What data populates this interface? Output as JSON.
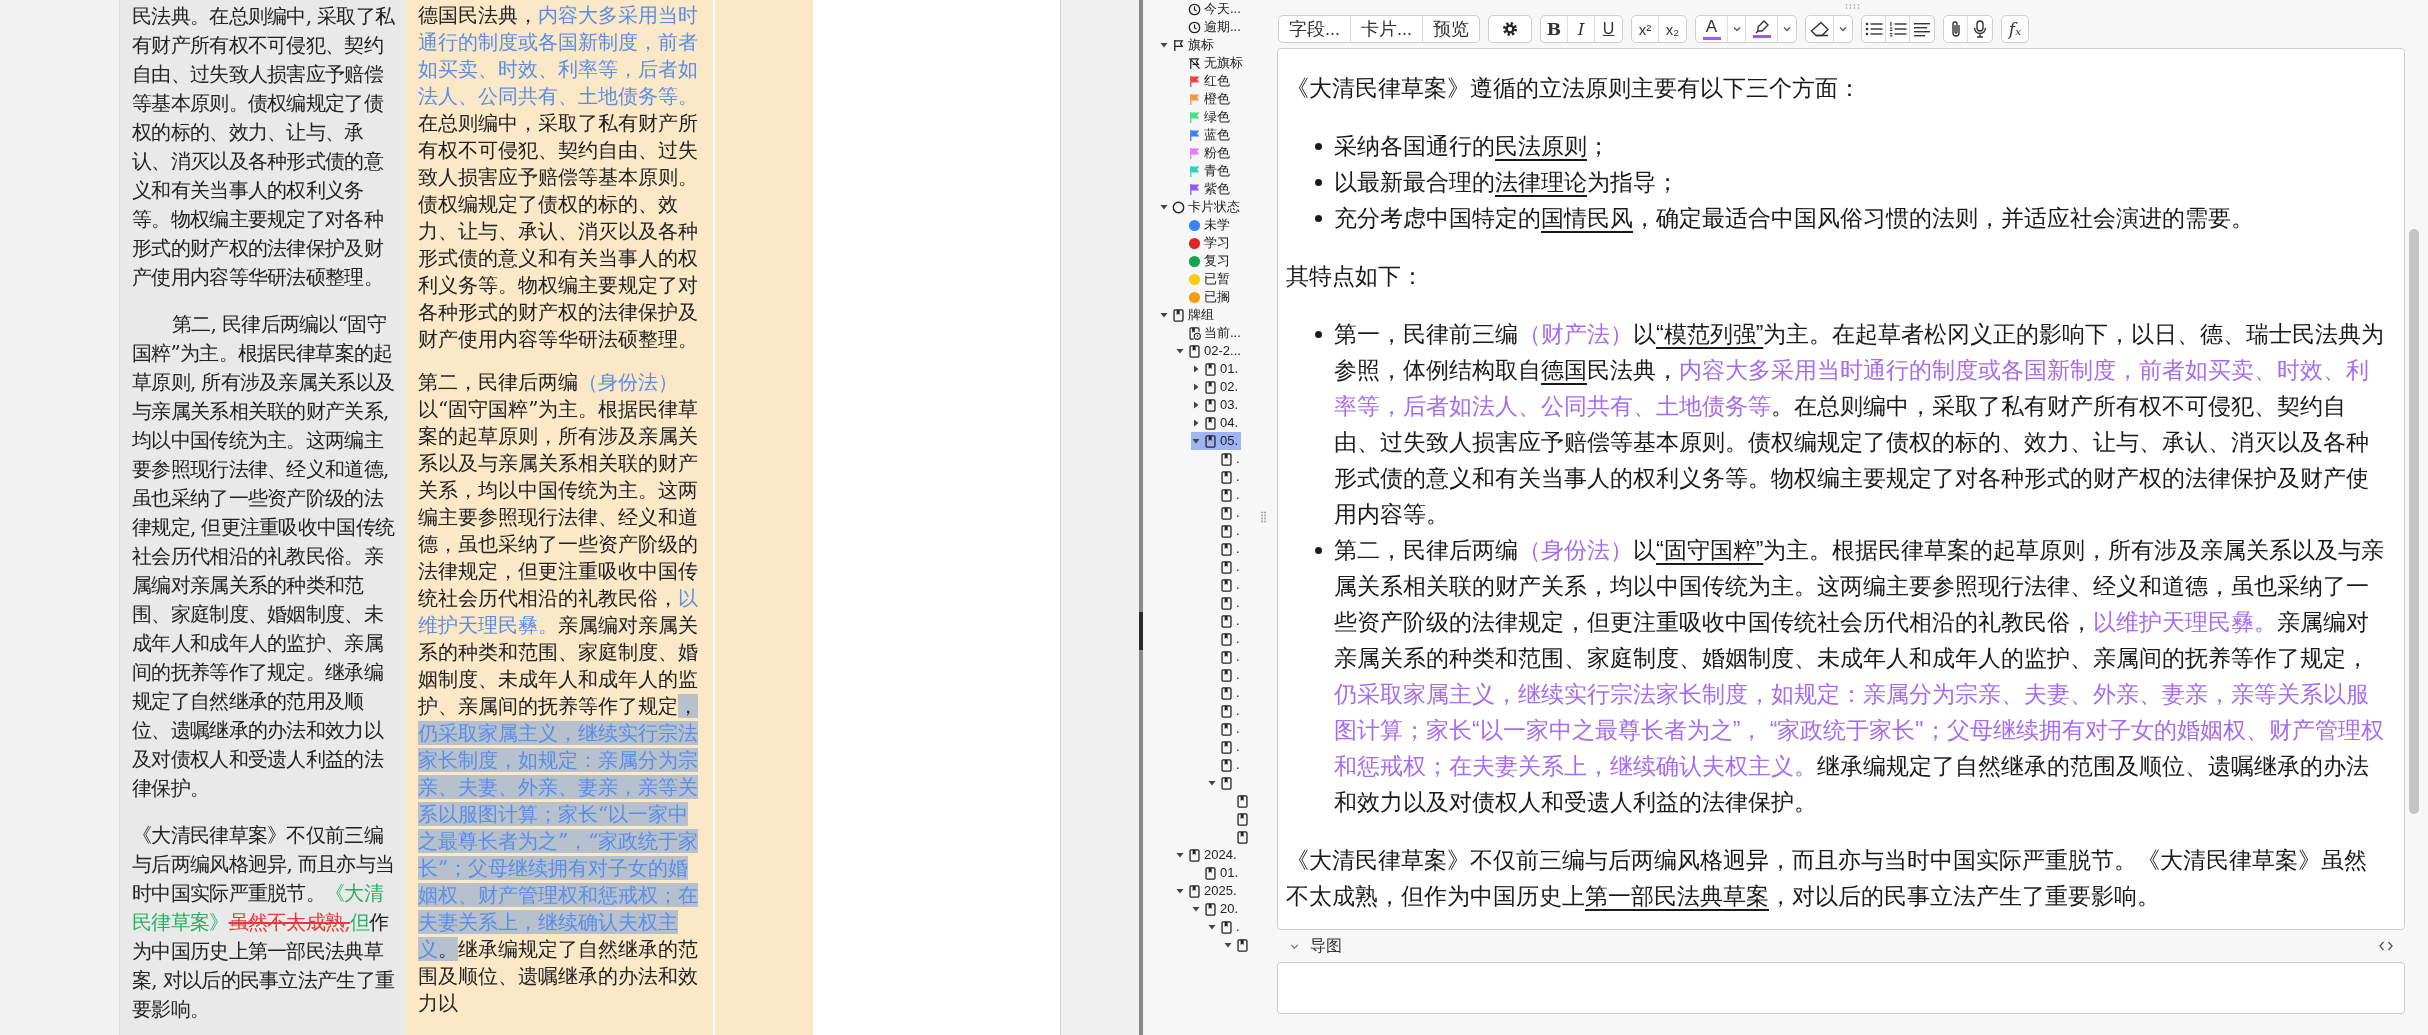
{
  "left_page": {
    "paragraphs": [
      {
        "indented": false,
        "runs": [
          {
            "kind": "plain",
            "text": "民法典。在总则编中, 采取了私有财产所有权不可侵犯、契约自由、过失致人损害应予赔偿等基本原则。债权编规定了债权的标的、效力、让与、承认、消灭以及各种形式债的意义和有关当事人的权利义务等。物权编主要规定了对各种形式的财产权的法律保护及财产使用内容等华研法硕整理。"
          }
        ]
      },
      {
        "indented": true,
        "runs": [
          {
            "kind": "plain",
            "text": "第二, 民律后两编以“固守国粹”为主。根据民律草案的起草原则, 所有涉及亲属关系以及与亲属关系相关联的财产关系, 均以中国传统为主。这两编主要参照现行法律、经义和道德, 虽也采纳了一些资产阶级的法律规定, 但更注重吸收中国传统社会历代相沿的礼教民俗。亲属编对亲属关系的种类和范围、家庭制度、婚姻制度、未成年人和成年人的监护、亲属间的抚养等作了规定。继承编规定了自然继承的范用及顺位、遗嘱继承的办法和效力以及对债权人和受遗人利益的法律保护。"
          }
        ]
      },
      {
        "indented": false,
        "runs": [
          {
            "kind": "plain",
            "text": "《大清民律草案》不仅前三编与后两编风格迥异, 而且亦与当时中国实际严重脱节。"
          },
          {
            "kind": "green",
            "text": "《大清民律草案》"
          },
          {
            "kind": "strike",
            "text": "虽然不太成熟,"
          },
          {
            "kind": "green",
            "text": "但"
          },
          {
            "kind": "plain",
            "text": "作为中国历史上第一部民法典草案, 对以后的民事立法产生了重要影响。"
          }
        ]
      }
    ]
  },
  "middle_page": {
    "paragraphs": [
      {
        "runs": [
          {
            "kind": "plain",
            "text": "德国民法典，"
          },
          {
            "kind": "blue",
            "text": "内容大多采用当时通行的制度或各国新制度，前者如买卖、时效、利率等，后者如法人、公同共有、土地债务等。"
          },
          {
            "kind": "plain",
            "text": "在总则编中，采取了私有财产所有权不可侵犯、契约自由、过失致人损害应予赔偿等基本原则。债权编规定了债权的标的、效力、让与、承认、消灭以及各种形式债的意义和有关当事人的权利义务等。物权编主要规定了对各种形式的财产权的法律保护及财产使用内容等华研法硕整理。"
          }
        ]
      },
      {
        "runs": [
          {
            "kind": "plain",
            "text": "第二，民律后两编"
          },
          {
            "kind": "blue",
            "text": "（身份法）"
          },
          {
            "kind": "plain",
            "text": "以“固守国粹”为主。根据民律草案的起草原则，所有涉及亲属关系以及与亲属关系相关联的财产关系，均以中国传统为主。这两编主要参照现行法律、经义和道德，虽也采纳了一些资产阶级的法律规定，但更注重吸收中国传统社会历代相沿的礼教民俗，"
          },
          {
            "kind": "blue",
            "text": "以维护天理民彝。"
          },
          {
            "kind": "plain",
            "text": "亲属编对亲属关系的种类和范围、家庭制度、婚姻制度、未成年人和成年人的监护、亲属间的抚养等作了规定"
          },
          {
            "kind": "highlight",
            "text": "，"
          },
          {
            "kind": "highlight-blue",
            "text": "仍采取家属主义，继续实行宗法家长制度，如规定：亲属分为宗亲、夫妻、外亲、妻亲，亲等关系以服图计算；家长“以一家中之最尊长者为之”，“家政统于家长”；父母继续拥有对子女的婚姻权、财产管理权和惩戒权；在夫妻关系上，继续确认夫权主义"
          },
          {
            "kind": "highlight",
            "text": "。"
          },
          {
            "kind": "plain",
            "text": "继承编规定了自然继承的范围及顺位、遗嘱继承的办法和效力以"
          }
        ]
      }
    ]
  },
  "sidebar": {
    "tree_top": [
      {
        "label": "今天...",
        "kind": "clock",
        "selected": false
      },
      {
        "label": "逾期...",
        "kind": "clock",
        "selected": false
      }
    ],
    "tree": [
      {
        "label": "旗标",
        "kind": "flag-outline",
        "expanded": true,
        "selected": false,
        "children": [
          {
            "label": "无旗标",
            "kind": "flag-off",
            "selected": false
          },
          {
            "label": "红色",
            "kind": "flag",
            "color": "#ef4444",
            "selected": false
          },
          {
            "label": "橙色",
            "kind": "flag",
            "color": "#fb923c",
            "selected": false
          },
          {
            "label": "绿色",
            "kind": "flag",
            "color": "#4ade80",
            "selected": false
          },
          {
            "label": "蓝色",
            "kind": "flag",
            "color": "#3b82f6",
            "selected": false
          },
          {
            "label": "粉色",
            "kind": "flag",
            "color": "#e879f9",
            "selected": false
          },
          {
            "label": "青色",
            "kind": "flag",
            "color": "#2dd4bf",
            "selected": false
          },
          {
            "label": "紫色",
            "kind": "flag",
            "color": "#8b5cf6",
            "selected": false
          }
        ]
      },
      {
        "label": "卡片状态",
        "kind": "circle",
        "expanded": true,
        "selected": false,
        "children": [
          {
            "label": "未学",
            "kind": "dot",
            "color": "#3b82f6",
            "selected": false
          },
          {
            "label": "学习",
            "kind": "dot",
            "color": "#dc2626",
            "selected": false
          },
          {
            "label": "复习",
            "kind": "dot",
            "color": "#16a34a",
            "selected": false
          },
          {
            "label": "已暂",
            "kind": "dot",
            "color": "#facc15",
            "selected": false
          },
          {
            "label": "已搁",
            "kind": "dot",
            "color": "#f59e0b",
            "selected": false
          }
        ]
      },
      {
        "label": "牌组",
        "kind": "deck",
        "expanded": true,
        "selected": false,
        "children": [
          {
            "label": "当前...",
            "kind": "deck-clock",
            "selected": false
          },
          {
            "label": "02-2...",
            "kind": "deck",
            "expanded": true,
            "selected": false,
            "children": [
              {
                "label": "01.",
                "kind": "deck",
                "expanded": false,
                "selected": false
              },
              {
                "label": "02.",
                "kind": "deck",
                "expanded": false,
                "selected": false
              },
              {
                "label": "03.",
                "kind": "deck",
                "expanded": false,
                "selected": false
              },
              {
                "label": "04.",
                "kind": "deck",
                "expanded": false,
                "selected": false
              },
              {
                "label": "05.",
                "kind": "deck",
                "expanded": true,
                "selected": true,
                "children": [
                  {
                    "label": ".",
                    "kind": "deck",
                    "selected": false
                  },
                  {
                    "label": ".",
                    "kind": "deck",
                    "selected": false
                  },
                  {
                    "label": ".",
                    "kind": "deck",
                    "selected": false
                  },
                  {
                    "label": ".",
                    "kind": "deck",
                    "selected": false
                  },
                  {
                    "label": ".",
                    "kind": "deck",
                    "selected": false
                  },
                  {
                    "label": ".",
                    "kind": "deck",
                    "selected": false
                  },
                  {
                    "label": ".",
                    "kind": "deck",
                    "selected": false
                  },
                  {
                    "label": ".",
                    "kind": "deck",
                    "selected": false
                  },
                  {
                    "label": ".",
                    "kind": "deck",
                    "selected": false
                  },
                  {
                    "label": ".",
                    "kind": "deck",
                    "selected": false
                  },
                  {
                    "label": ".",
                    "kind": "deck",
                    "selected": false
                  },
                  {
                    "label": ".",
                    "kind": "deck",
                    "selected": false
                  },
                  {
                    "label": ".",
                    "kind": "deck",
                    "selected": false
                  },
                  {
                    "label": ".",
                    "kind": "deck",
                    "selected": false
                  },
                  {
                    "label": ".",
                    "kind": "deck",
                    "selected": false
                  },
                  {
                    "label": ".",
                    "kind": "deck",
                    "selected": false
                  },
                  {
                    "label": ".",
                    "kind": "deck",
                    "selected": false
                  },
                  {
                    "label": ".",
                    "kind": "deck",
                    "selected": false
                  },
                  {
                    "kind": "deck",
                    "expanded": true,
                    "selected": false,
                    "children": [
                      {
                        "kind": "deck",
                        "selected": false
                      },
                      {
                        "kind": "deck",
                        "selected": false
                      },
                      {
                        "kind": "deck",
                        "selected": false
                      }
                    ]
                  }
                ]
              }
            ]
          },
          {
            "label": "2024.",
            "kind": "deck",
            "expanded": true,
            "selected": false,
            "children": [
              {
                "label": "01.",
                "kind": "deck",
                "selected": false
              }
            ]
          },
          {
            "label": "2025.",
            "kind": "deck",
            "expanded": true,
            "selected": false,
            "children": [
              {
                "label": "20.",
                "kind": "deck",
                "expanded": true,
                "selected": false,
                "children": [
                  {
                    "label": ".",
                    "kind": "deck",
                    "expanded": true,
                    "selected": false,
                    "children": [
                      {
                        "kind": "deck",
                        "expanded": true,
                        "selected": false
                      }
                    ]
                  }
                ]
              }
            ]
          }
        ]
      }
    ]
  },
  "toolbar": {
    "groups": [
      {
        "buttons": [
          {
            "kind": "text",
            "label": "字段..."
          },
          {
            "kind": "text",
            "label": "卡片..."
          },
          {
            "kind": "text",
            "label": "预览"
          }
        ]
      },
      {
        "buttons": [
          {
            "kind": "settings"
          }
        ]
      },
      {
        "buttons": [
          {
            "kind": "bold",
            "label": "B"
          },
          {
            "kind": "italic",
            "label": "I"
          },
          {
            "kind": "underline",
            "label": "U"
          }
        ]
      },
      {
        "buttons": [
          {
            "kind": "superscript",
            "label": "x²"
          },
          {
            "kind": "subscript",
            "label": "x₂"
          }
        ]
      },
      {
        "buttons": [
          {
            "kind": "text-color",
            "label": "A",
            "color": "#a855f7"
          },
          {
            "kind": "dropdown"
          },
          {
            "kind": "highlight",
            "color": "#a855f7"
          },
          {
            "kind": "dropdown"
          }
        ]
      },
      {
        "buttons": [
          {
            "kind": "eraser"
          },
          {
            "kind": "dropdown"
          }
        ]
      },
      {
        "buttons": [
          {
            "kind": "bullet-list"
          },
          {
            "kind": "numbered-list"
          },
          {
            "kind": "align"
          }
        ]
      },
      {
        "buttons": [
          {
            "kind": "attach"
          },
          {
            "kind": "mic"
          }
        ]
      },
      {
        "buttons": [
          {
            "kind": "function",
            "label": "fₓ"
          }
        ]
      }
    ]
  },
  "editor": {
    "blocks": [
      {
        "kind": "paragraph",
        "runs": [
          {
            "kind": "plain",
            "text": "《大清民律草案》遵循的立法原则主要有以下三个方面："
          }
        ]
      },
      {
        "kind": "list",
        "items": [
          {
            "runs": [
              {
                "kind": "plain",
                "text": "采纳各国通行的"
              },
              {
                "kind": "underline",
                "text": "民法原则"
              },
              {
                "kind": "plain",
                "text": "；"
              }
            ]
          },
          {
            "runs": [
              {
                "kind": "plain",
                "text": "以最新最合理的"
              },
              {
                "kind": "underline",
                "text": "法律理论"
              },
              {
                "kind": "plain",
                "text": "为指导；"
              }
            ]
          },
          {
            "runs": [
              {
                "kind": "plain",
                "text": "充分考虑中国特定的"
              },
              {
                "kind": "underline",
                "text": "国情民风"
              },
              {
                "kind": "plain",
                "text": "，确定最适合中国风俗习惯的法则，并适应社会演进的需要。"
              }
            ]
          }
        ]
      },
      {
        "kind": "paragraph",
        "runs": [
          {
            "kind": "plain",
            "text": "其特点如下："
          }
        ]
      },
      {
        "kind": "list",
        "items": [
          {
            "runs": [
              {
                "kind": "plain",
                "text": "第一，民律前三编"
              },
              {
                "kind": "purple",
                "text": "（财产法）"
              },
              {
                "kind": "plain",
                "text": "以"
              },
              {
                "kind": "underline",
                "text": "“模范列强”"
              },
              {
                "kind": "plain",
                "text": "为主。在起草者松冈义正的影响下，以日、德、瑞士民法典为参照，体例结构取自"
              },
              {
                "kind": "underline",
                "text": "德国"
              },
              {
                "kind": "plain",
                "text": "民法典，"
              },
              {
                "kind": "purple",
                "text": "内容大多采用当时通行的制度或各国新制度，前者如买卖、时效、利率等，后者如法人、公同共有、土地债务等"
              },
              {
                "kind": "plain",
                "text": "。在总则编中，采取了私有财产所有权不可侵犯、契约自由、过失致人损害应予赔偿等基本原则。债权编规定了债权的标的、效力、让与、承认、消灭以及各种形式债的意义和有关当事人的权利义务等。物权编主要规定了对各种形式的财产权的法律保护及财产使用内容等。"
              }
            ]
          },
          {
            "runs": [
              {
                "kind": "plain",
                "text": "第二，民律后两编"
              },
              {
                "kind": "purple",
                "text": "（身份法）"
              },
              {
                "kind": "plain",
                "text": "以"
              },
              {
                "kind": "underline",
                "text": "“固守国粹”"
              },
              {
                "kind": "plain",
                "text": "为主。根据民律草案的起草原则，所有涉及亲属关系以及与亲属关系相关联的财产关系，均以中国传统为主。这两编主要参照现行法律、经义和道德，虽也采纳了一些资产阶级的法律规定，但更注重吸收中国传统社会历代相沿的礼教民俗，"
              },
              {
                "kind": "purple",
                "text": "以维护天理民彝。"
              },
              {
                "kind": "plain",
                "text": "亲属编对亲属关系的种类和范围、家庭制度、婚姻制度、未成年人和成年人的监护、亲属间的抚养等作了规定，"
              },
              {
                "kind": "purple",
                "text": "仍采取家属主义，继续实行宗法家长制度，如规定：亲属分为宗亲、夫妻、外亲、妻亲，亲等关系以服图计算；家长“以一家中之最尊长者为之”， “家政统于家长\"；父母继续拥有对子女的婚姻权、财产管理权和惩戒权；在夫妻关系上，继续确认夫权主义。"
              },
              {
                "kind": "plain",
                "text": "继承编规定了自然继承的范围及顺位、遗嘱继承的办法和效力以及对债权人和受遗人利益的法律保护。"
              }
            ]
          }
        ]
      },
      {
        "kind": "paragraph",
        "runs": [
          {
            "kind": "plain",
            "text": "《大清民律草案》不仅前三编与后两编风格迥异，而且亦与当时中国实际严重脱节。《大清民律草案》虽然不太成熟，但作为中国历史上"
          },
          {
            "kind": "underline",
            "text": "第一部民法典草案"
          },
          {
            "kind": "plain",
            "text": "，对以后的民事立法产生了重要影响。"
          }
        ]
      }
    ],
    "sections": [
      {
        "title": "导图"
      }
    ]
  }
}
